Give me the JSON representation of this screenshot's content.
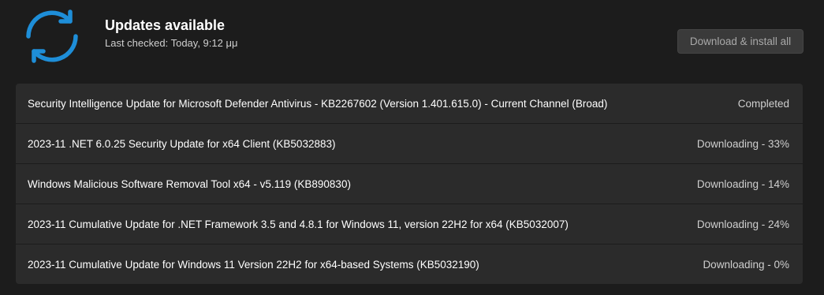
{
  "header": {
    "title": "Updates available",
    "last_checked": "Last checked: Today, 9:12 μμ",
    "install_button": "Download & install all",
    "icon": "sync-icon",
    "accent_color": "#1e8ed8"
  },
  "updates": [
    {
      "name": "Security Intelligence Update for Microsoft Defender Antivirus - KB2267602 (Version 1.401.615.0) - Current Channel (Broad)",
      "status": "Completed"
    },
    {
      "name": "2023-11 .NET 6.0.25 Security Update for x64 Client (KB5032883)",
      "status": "Downloading - 33%"
    },
    {
      "name": "Windows Malicious Software Removal Tool x64 - v5.119 (KB890830)",
      "status": "Downloading - 14%"
    },
    {
      "name": "2023-11 Cumulative Update for .NET Framework 3.5 and 4.8.1 for Windows 11, version 22H2 for x64 (KB5032007)",
      "status": "Downloading - 24%"
    },
    {
      "name": "2023-11 Cumulative Update for Windows 11 Version 22H2 for x64-based Systems (KB5032190)",
      "status": "Downloading - 0%"
    }
  ]
}
